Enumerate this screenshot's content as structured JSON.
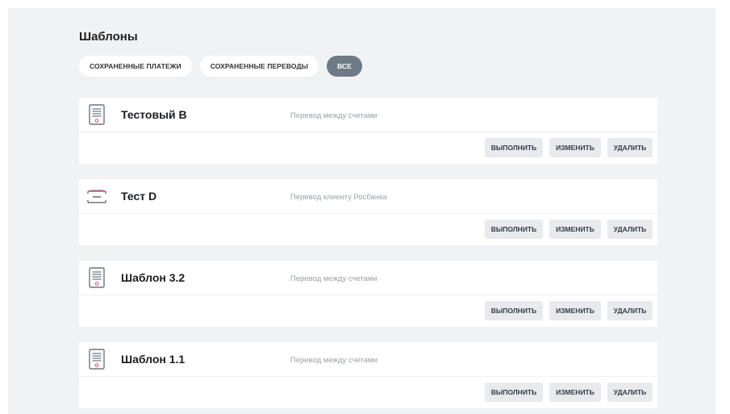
{
  "page": {
    "title": "Шаблоны"
  },
  "filters": [
    {
      "label": "СОХРАНЕННЫЕ ПЛАТЕЖИ",
      "active": false
    },
    {
      "label": "СОХРАНЕННЫЕ ПЕРЕВОДЫ",
      "active": false
    },
    {
      "label": "ВСЕ",
      "active": true
    }
  ],
  "actions": {
    "execute": "ВЫПОЛНИТЬ",
    "edit": "ИЗМЕНИТЬ",
    "delete": "УДАЛИТЬ"
  },
  "templates": [
    {
      "name": "Тестовый В",
      "description": "Перевод между счетами",
      "icon": "document-icon"
    },
    {
      "name": "Тест D",
      "description": "Перевод клиенту Росбанка",
      "icon": "envelope-icon"
    },
    {
      "name": "Шаблон 3.2",
      "description": "Перевод между счетами",
      "icon": "document-icon"
    },
    {
      "name": "Шаблон 1.1",
      "description": "Перевод между счетами",
      "icon": "document-icon"
    }
  ],
  "colors": {
    "background": "#f1f2f4",
    "card": "#ffffff",
    "active_chip": "#6f7a87",
    "button": "#e8eaed",
    "icon_accent": "#e0677c"
  }
}
